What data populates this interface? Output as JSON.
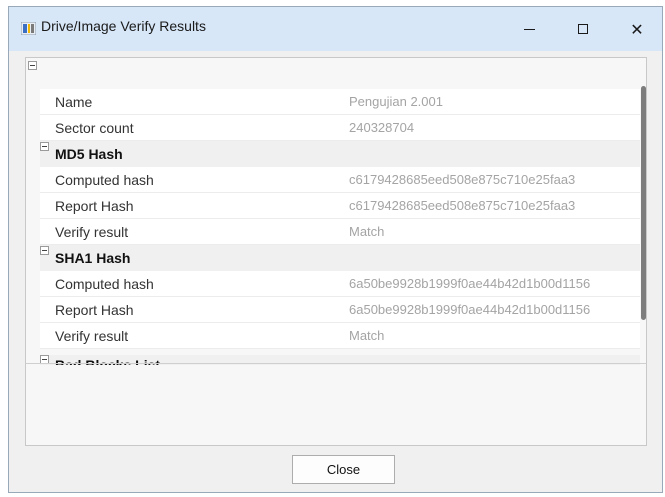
{
  "window": {
    "title": "Drive/Image Verify Results",
    "controls": {
      "minimize": "—",
      "maximize": "☐",
      "close": "✕"
    }
  },
  "general": {
    "rows": [
      {
        "label": "Name",
        "value": "Pengujian 2.001"
      },
      {
        "label": "Sector count",
        "value": "240328704"
      }
    ]
  },
  "md5": {
    "title": "MD5 Hash",
    "rows": [
      {
        "label": "Computed hash",
        "value": "c6179428685eed508e875c710e25faa3"
      },
      {
        "label": "Report Hash",
        "value": "c6179428685eed508e875c710e25faa3"
      },
      {
        "label": "Verify result",
        "value": "Match"
      }
    ]
  },
  "sha1": {
    "title": "SHA1 Hash",
    "rows": [
      {
        "label": "Computed hash",
        "value": "6a50be9928b1999f0ae44b42d1b00d1156"
      },
      {
        "label": "Report Hash",
        "value": "6a50be9928b1999f0ae44b42d1b00d1156"
      },
      {
        "label": "Verify result",
        "value": "Match"
      }
    ]
  },
  "bad_blocks": {
    "title": "Bad Blocks List"
  },
  "footer": {
    "close_label": "Close"
  },
  "colors": {
    "titlebar": "#d7e7f8",
    "value_text": "#a4a4a4",
    "scroll_thumb": "#7d7d7d"
  }
}
